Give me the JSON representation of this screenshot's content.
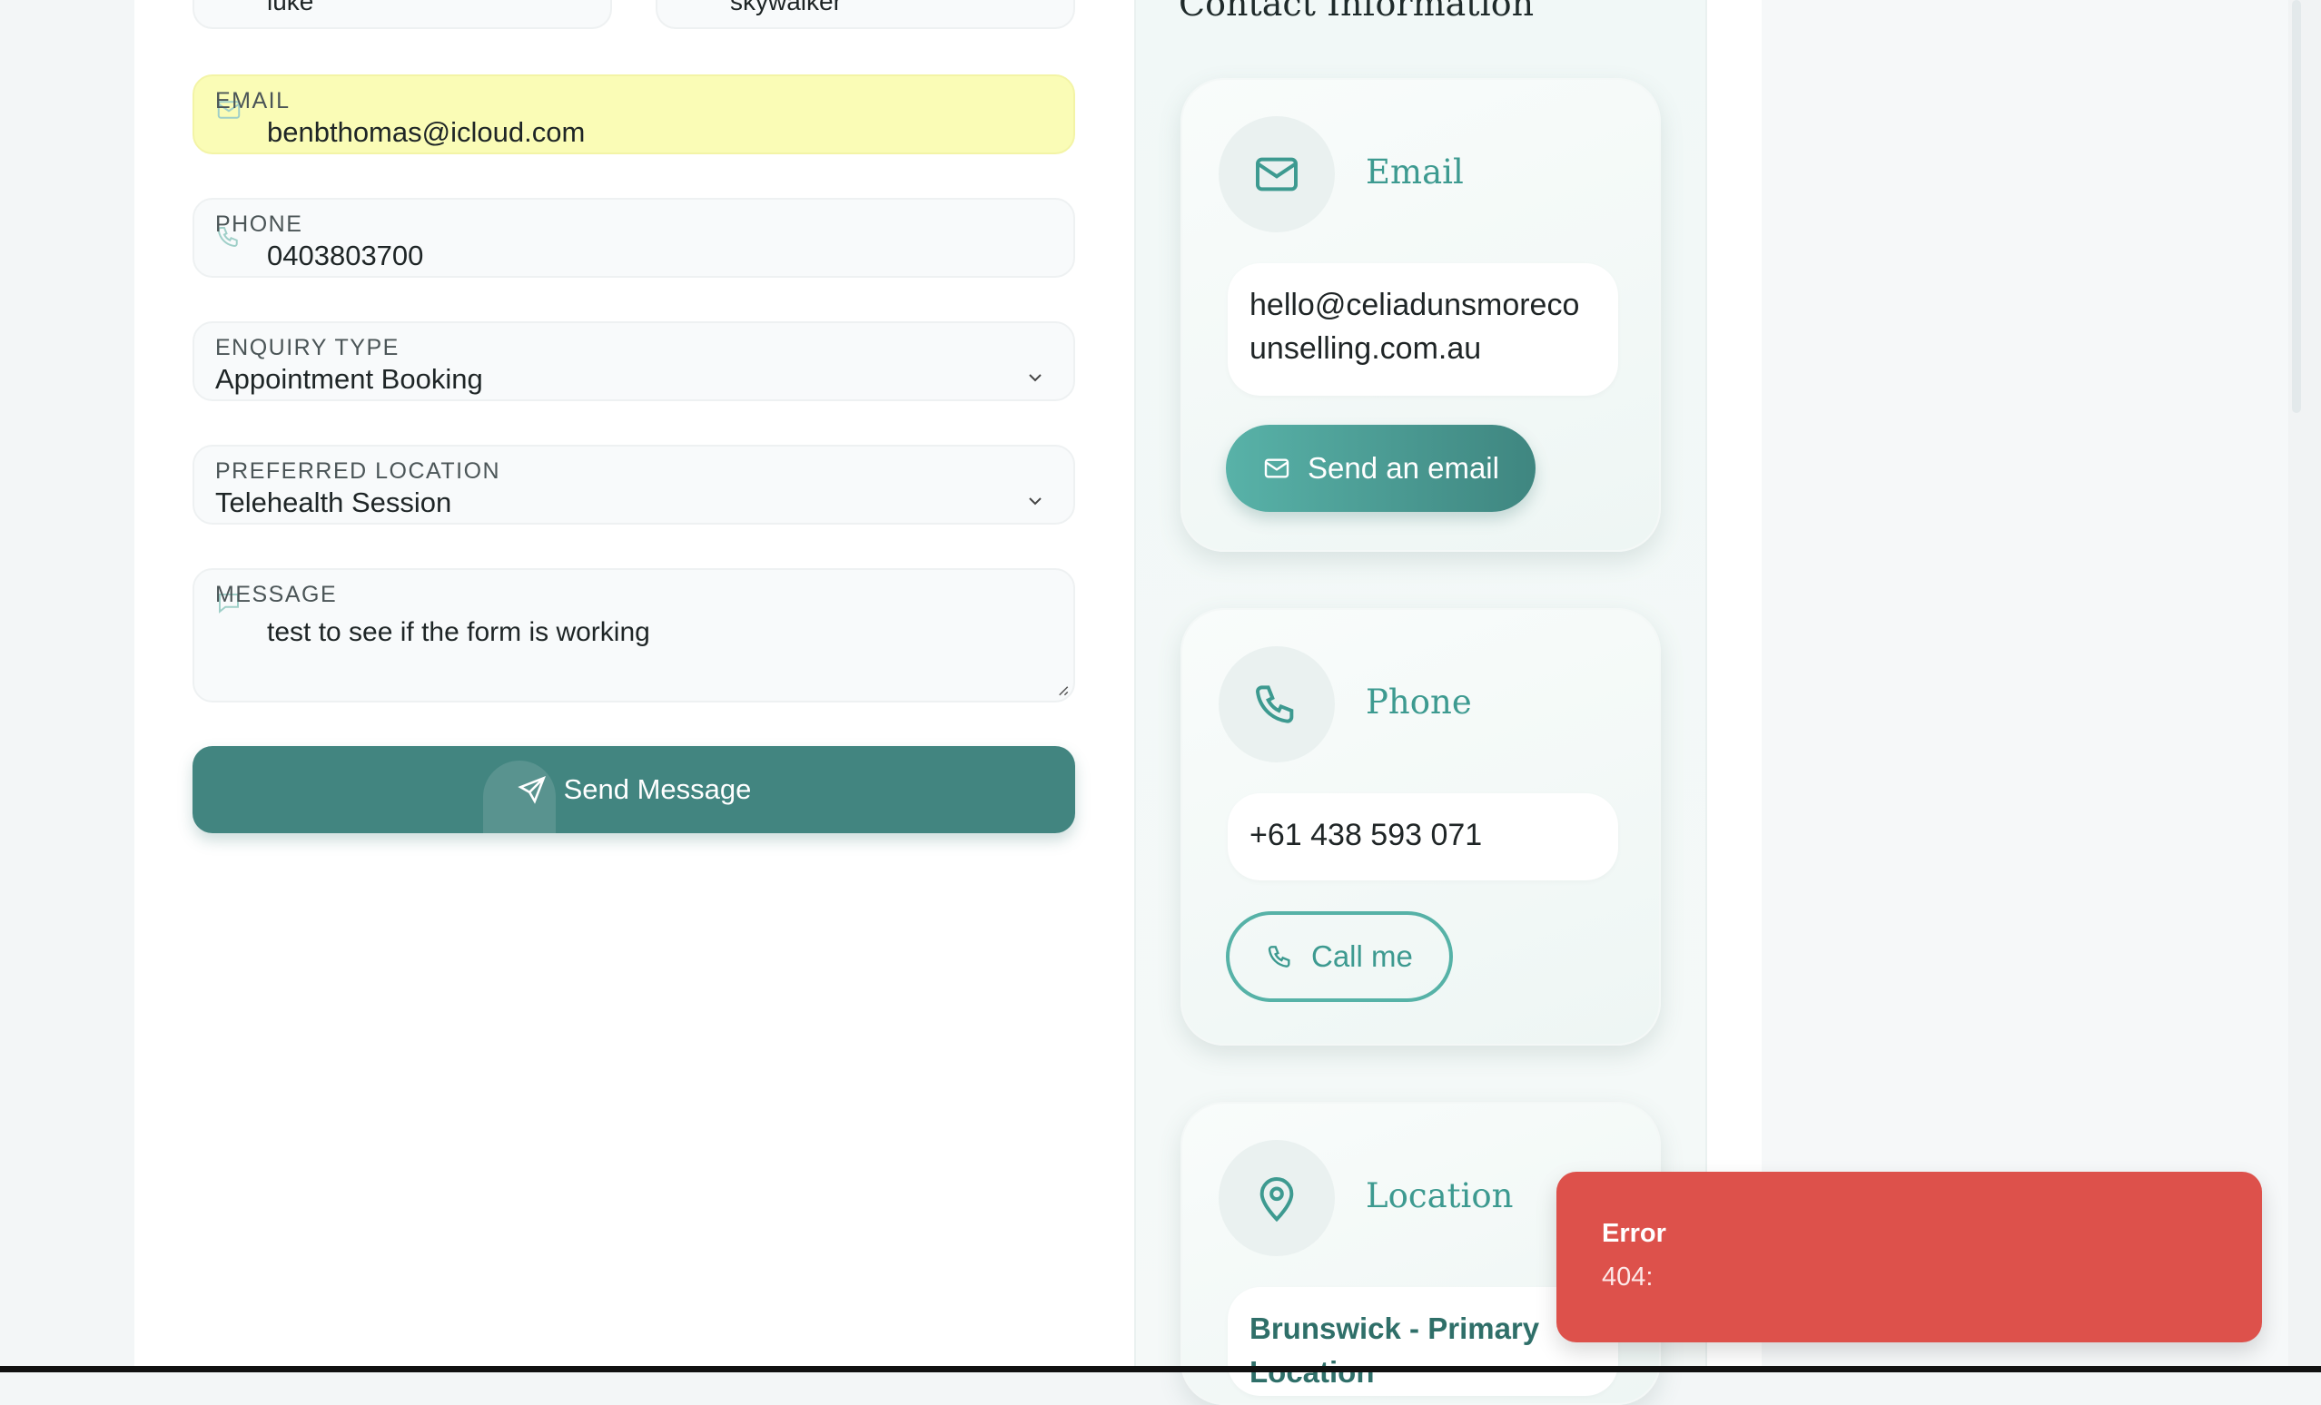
{
  "form": {
    "first_name_value": "luke",
    "last_name_value": "skywalker",
    "email": {
      "label": "EMAIL",
      "value": "benbthomas@icloud.com"
    },
    "phone": {
      "label": "PHONE",
      "value": "0403803700"
    },
    "enquiry": {
      "label": "ENQUIRY TYPE",
      "value": "Appointment Booking"
    },
    "location": {
      "label": "PREFERRED LOCATION",
      "value": "Telehealth Session"
    },
    "message": {
      "label": "MESSAGE",
      "value": "test to see if the form is working"
    },
    "submit_label": "Send Message"
  },
  "contact": {
    "title": "Contact Information",
    "email_card": {
      "title": "Email",
      "address": "hello@celiadunsmorecounselling.com.au",
      "button": "Send an email"
    },
    "phone_card": {
      "title": "Phone",
      "number": "+61 438 593 071",
      "button": "Call me"
    },
    "location_card": {
      "title": "Location",
      "place": "Brunswick - Primary Location"
    }
  },
  "toast": {
    "title": "Error",
    "message": "404:"
  },
  "colors": {
    "accent": "#428580",
    "teal_text": "#3d9a90",
    "error": "#dd514b",
    "autofill": "#fafcb6"
  },
  "icons": [
    "mail-icon",
    "phone-icon",
    "chevron-down-icon",
    "message-icon",
    "send-icon",
    "location-pin-icon"
  ]
}
